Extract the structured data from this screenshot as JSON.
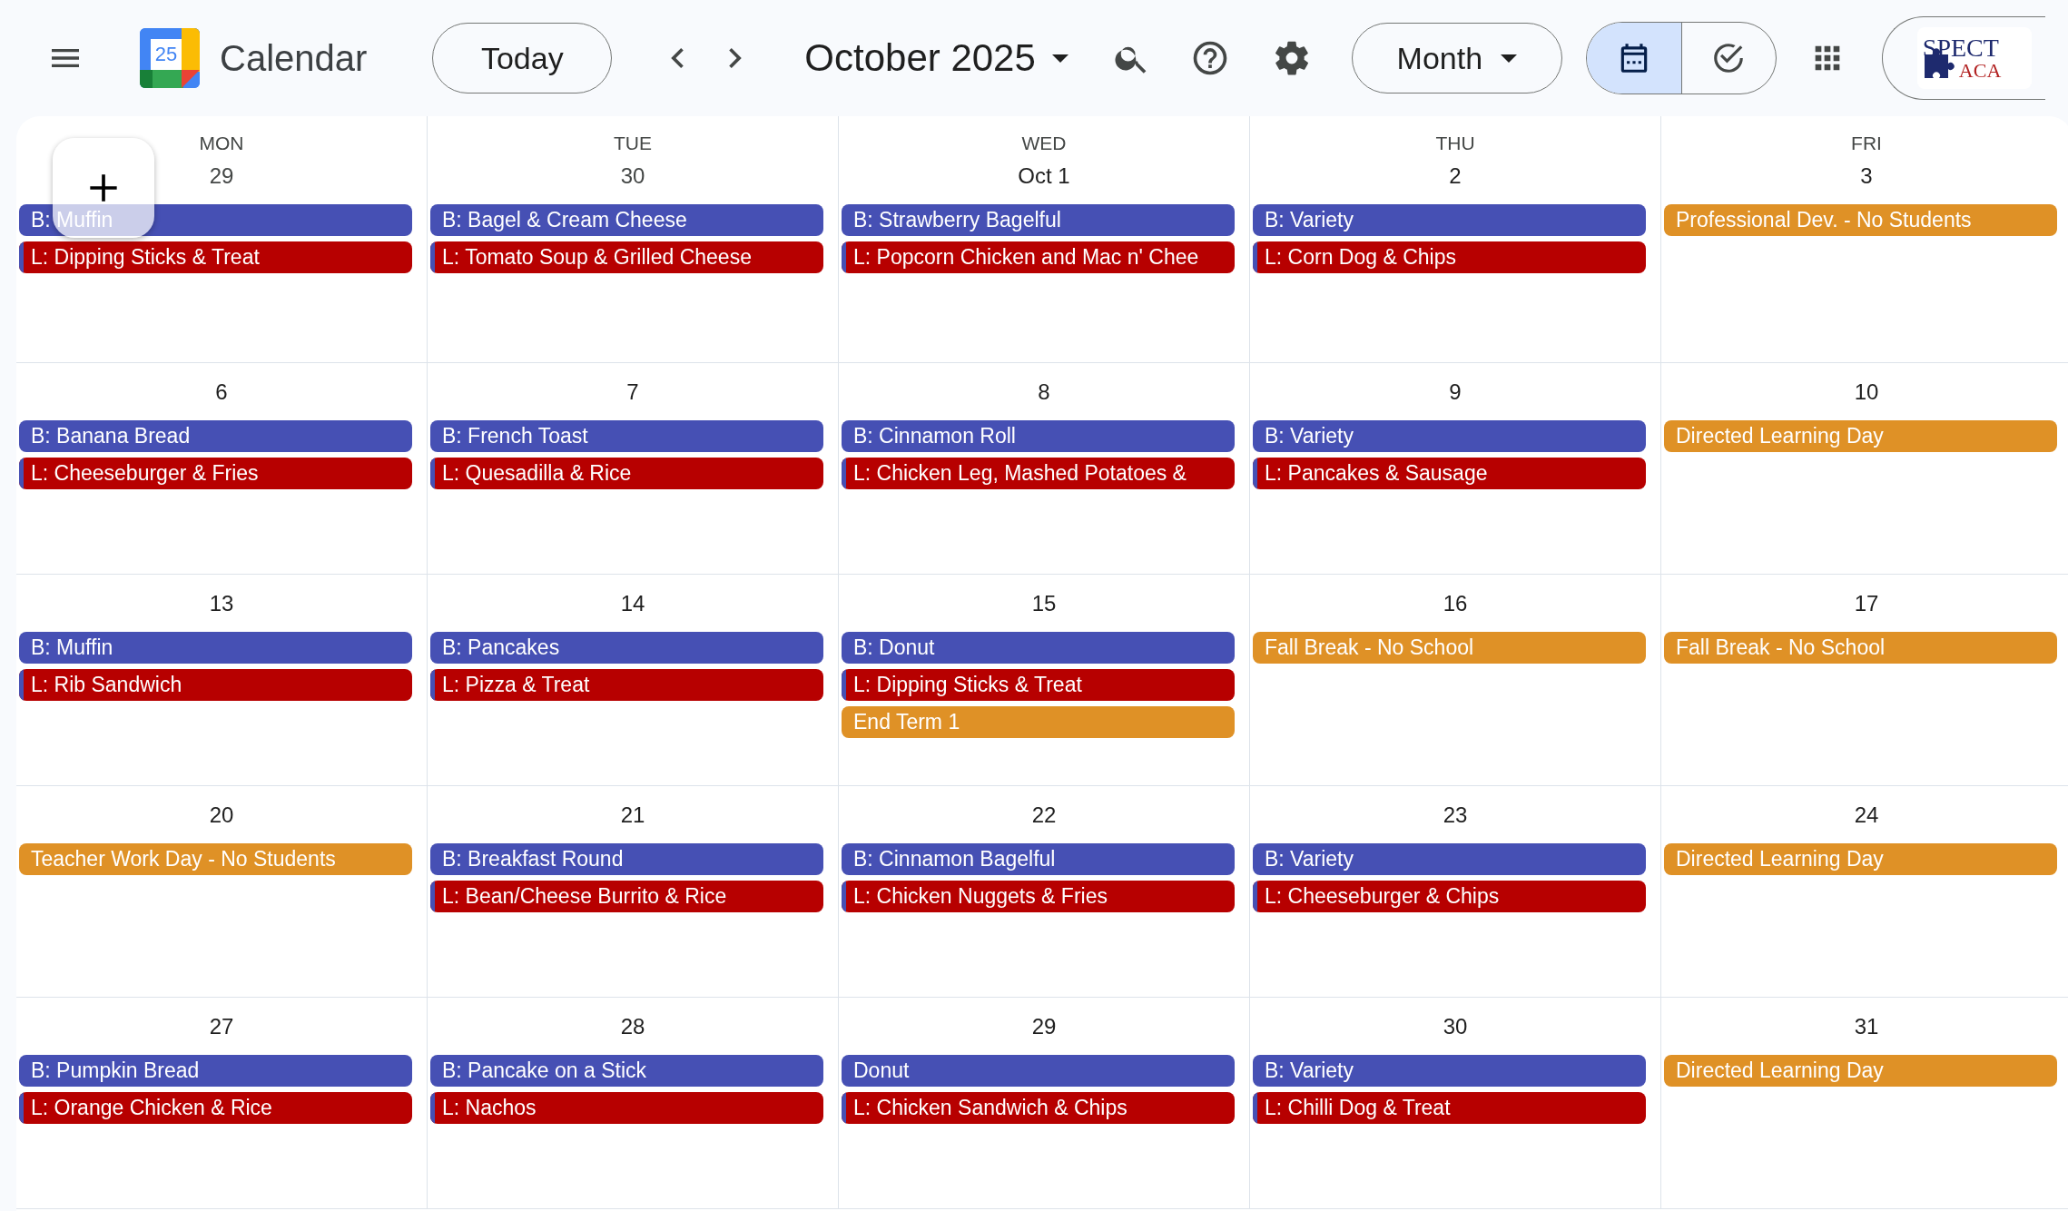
{
  "header": {
    "logo_day": "25",
    "app_name": "Calendar",
    "today_button": "Today",
    "period": "October 2025",
    "view_button": "Month",
    "view_toggle": [
      {
        "kind": "calendar",
        "selected": true
      },
      {
        "kind": "tasks",
        "selected": false
      }
    ],
    "account_logo": {
      "line1": "SPECT",
      "line2": "ACA"
    }
  },
  "day_names": [
    "MON",
    "TUE",
    "WED",
    "THU",
    "FRI"
  ],
  "weeks": [
    {
      "days": [
        {
          "date": "29",
          "in_month": false,
          "events": [
            {
              "title": "B: Muffin",
              "color": "#4650b4",
              "kind": "breakfast"
            },
            {
              "title": "L: Dipping Sticks & Treat",
              "color": "#b70000",
              "kind": "lunch"
            }
          ]
        },
        {
          "date": "30",
          "in_month": false,
          "events": [
            {
              "title": "B: Bagel & Cream Cheese",
              "color": "#4650b4",
              "kind": "breakfast"
            },
            {
              "title": "L: Tomato Soup & Grilled Cheese",
              "color": "#b70000",
              "kind": "lunch"
            }
          ]
        },
        {
          "date": "Oct 1",
          "in_month": true,
          "events": [
            {
              "title": "B: Strawberry Bagelful",
              "color": "#4650b4",
              "kind": "breakfast"
            },
            {
              "title": "L: Popcorn Chicken and Mac n' Chee",
              "color": "#b70000",
              "kind": "lunch"
            }
          ]
        },
        {
          "date": "2",
          "in_month": true,
          "events": [
            {
              "title": "B: Variety",
              "color": "#4650b4",
              "kind": "breakfast"
            },
            {
              "title": "L: Corn Dog & Chips",
              "color": "#b70000",
              "kind": "lunch"
            }
          ]
        },
        {
          "date": "3",
          "in_month": true,
          "events": [
            {
              "title": "Professional Dev. - No Students",
              "color": "#df9126",
              "kind": "note"
            }
          ]
        }
      ]
    },
    {
      "days": [
        {
          "date": "6",
          "in_month": true,
          "events": [
            {
              "title": "B: Banana Bread",
              "color": "#4650b4",
              "kind": "breakfast"
            },
            {
              "title": "L: Cheeseburger & Fries",
              "color": "#b70000",
              "kind": "lunch"
            }
          ]
        },
        {
          "date": "7",
          "in_month": true,
          "events": [
            {
              "title": "B: French Toast",
              "color": "#4650b4",
              "kind": "breakfast"
            },
            {
              "title": "L: Quesadilla & Rice",
              "color": "#b70000",
              "kind": "lunch"
            }
          ]
        },
        {
          "date": "8",
          "in_month": true,
          "events": [
            {
              "title": "B: Cinnamon Roll",
              "color": "#4650b4",
              "kind": "breakfast"
            },
            {
              "title": "L: Chicken Leg, Mashed Potatoes &",
              "color": "#b70000",
              "kind": "lunch"
            }
          ]
        },
        {
          "date": "9",
          "in_month": true,
          "events": [
            {
              "title": "B: Variety",
              "color": "#4650b4",
              "kind": "breakfast"
            },
            {
              "title": "L: Pancakes & Sausage",
              "color": "#b70000",
              "kind": "lunch"
            }
          ]
        },
        {
          "date": "10",
          "in_month": true,
          "events": [
            {
              "title": "Directed Learning Day",
              "color": "#df9126",
              "kind": "note"
            }
          ]
        }
      ]
    },
    {
      "days": [
        {
          "date": "13",
          "in_month": true,
          "events": [
            {
              "title": "B: Muffin",
              "color": "#4650b4",
              "kind": "breakfast"
            },
            {
              "title": "L: Rib Sandwich",
              "color": "#b70000",
              "kind": "lunch"
            }
          ]
        },
        {
          "date": "14",
          "in_month": true,
          "events": [
            {
              "title": "B: Pancakes",
              "color": "#4650b4",
              "kind": "breakfast"
            },
            {
              "title": "L: Pizza & Treat",
              "color": "#b70000",
              "kind": "lunch"
            }
          ]
        },
        {
          "date": "15",
          "in_month": true,
          "events": [
            {
              "title": "B: Donut",
              "color": "#4650b4",
              "kind": "breakfast"
            },
            {
              "title": "L: Dipping Sticks & Treat",
              "color": "#b70000",
              "kind": "lunch"
            },
            {
              "title": "End Term 1",
              "color": "#df9126",
              "kind": "note"
            }
          ]
        },
        {
          "date": "16",
          "in_month": true,
          "events": [
            {
              "title": "Fall Break - No School",
              "color": "#df9126",
              "kind": "note"
            }
          ]
        },
        {
          "date": "17",
          "in_month": true,
          "events": [
            {
              "title": "Fall Break - No School",
              "color": "#df9126",
              "kind": "note"
            }
          ]
        }
      ]
    },
    {
      "days": [
        {
          "date": "20",
          "in_month": true,
          "events": [
            {
              "title": "Teacher Work Day - No Students",
              "color": "#df9126",
              "kind": "note"
            }
          ]
        },
        {
          "date": "21",
          "in_month": true,
          "events": [
            {
              "title": "B: Breakfast Round",
              "color": "#4650b4",
              "kind": "breakfast"
            },
            {
              "title": "L: Bean/Cheese Burrito & Rice",
              "color": "#b70000",
              "kind": "lunch"
            }
          ]
        },
        {
          "date": "22",
          "in_month": true,
          "events": [
            {
              "title": "B: Cinnamon Bagelful",
              "color": "#4650b4",
              "kind": "breakfast"
            },
            {
              "title": "L: Chicken Nuggets & Fries",
              "color": "#b70000",
              "kind": "lunch"
            }
          ]
        },
        {
          "date": "23",
          "in_month": true,
          "events": [
            {
              "title": "B: Variety",
              "color": "#4650b4",
              "kind": "breakfast"
            },
            {
              "title": "L: Cheeseburger & Chips",
              "color": "#b70000",
              "kind": "lunch"
            }
          ]
        },
        {
          "date": "24",
          "in_month": true,
          "events": [
            {
              "title": "Directed Learning Day",
              "color": "#df9126",
              "kind": "note"
            }
          ]
        }
      ]
    },
    {
      "days": [
        {
          "date": "27",
          "in_month": true,
          "events": [
            {
              "title": "B: Pumpkin Bread",
              "color": "#4650b4",
              "kind": "breakfast"
            },
            {
              "title": "L: Orange Chicken & Rice",
              "color": "#b70000",
              "kind": "lunch"
            }
          ]
        },
        {
          "date": "28",
          "in_month": true,
          "events": [
            {
              "title": "B: Pancake on a Stick",
              "color": "#4650b4",
              "kind": "breakfast"
            },
            {
              "title": "L: Nachos",
              "color": "#b70000",
              "kind": "lunch"
            }
          ]
        },
        {
          "date": "29",
          "in_month": true,
          "events": [
            {
              "title": "Donut",
              "color": "#4650b4",
              "kind": "breakfast"
            },
            {
              "title": "L: Chicken Sandwich & Chips",
              "color": "#b70000",
              "kind": "lunch"
            }
          ]
        },
        {
          "date": "30",
          "in_month": true,
          "events": [
            {
              "title": "B: Variety",
              "color": "#4650b4",
              "kind": "breakfast"
            },
            {
              "title": "L: Chilli Dog & Treat",
              "color": "#b70000",
              "kind": "lunch"
            }
          ]
        },
        {
          "date": "31",
          "in_month": true,
          "events": [
            {
              "title": "Directed Learning Day",
              "color": "#df9126",
              "kind": "note"
            }
          ]
        }
      ]
    }
  ]
}
